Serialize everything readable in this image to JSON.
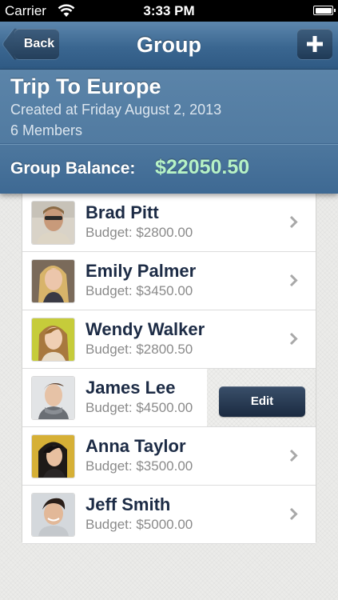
{
  "status_bar": {
    "carrier": "Carrier",
    "time": "3:33 PM"
  },
  "nav": {
    "title": "Group",
    "back_label": "Back",
    "add_icon": "plus-icon"
  },
  "group": {
    "name": "Trip To Europe",
    "created": "Created at Friday August 2, 2013",
    "members": "6 Members",
    "balance_label": "Group Balance:",
    "balance_value": "$22050.50"
  },
  "members": [
    {
      "name": "Brad Pitt",
      "budget": "Budget: $2800.00"
    },
    {
      "name": "Emily Palmer",
      "budget": "Budget: $3450.00"
    },
    {
      "name": "Wendy Walker",
      "budget": "Budget: $2800.50"
    },
    {
      "name": "James Lee",
      "budget": "Budget: $4500.00"
    },
    {
      "name": "Anna Taylor",
      "budget": "Budget: $3500.00"
    },
    {
      "name": "Jeff Smith",
      "budget": "Budget: $5000.00"
    }
  ],
  "swipe_action": {
    "edit_label": "Edit"
  },
  "colors": {
    "nav_blue": "#3a6690",
    "balance_green": "#b6f2c6",
    "name_text": "#1c2b45"
  }
}
